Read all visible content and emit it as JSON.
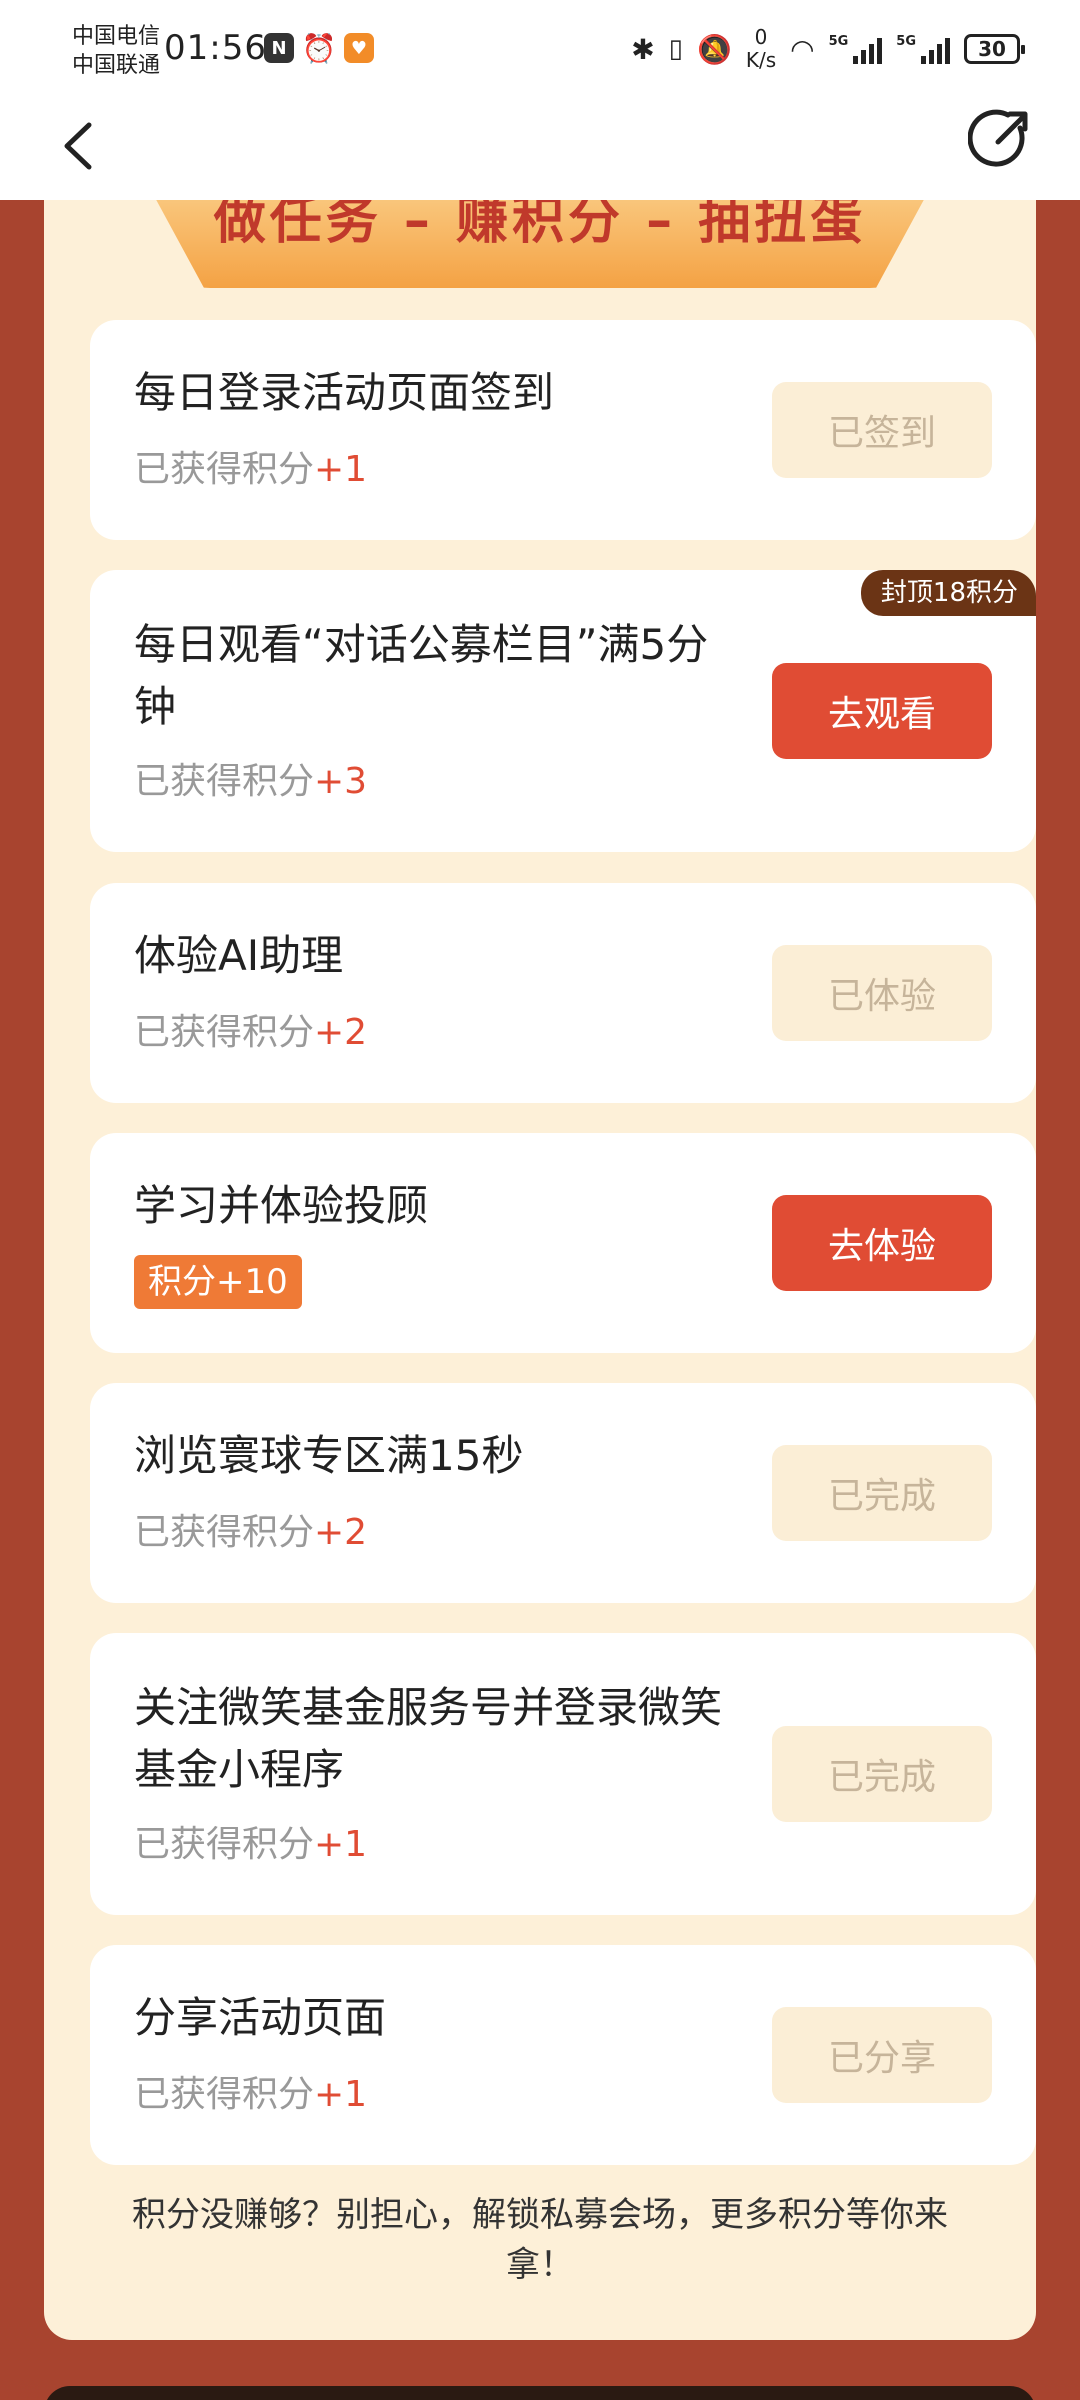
{
  "status_bar": {
    "carrier_1": "中国电信",
    "carrier_2": "中国联通",
    "time": "01:56",
    "net_speed_value": "0",
    "net_speed_unit": "K/s",
    "signal_1_label": "5G",
    "signal_2_label": "5G",
    "battery": "30"
  },
  "nav": {
    "back_icon": "chevron-left-icon",
    "share_icon": "share-icon"
  },
  "banner": {
    "title": "做任务 – 赚积分 – 抽扭蛋"
  },
  "tasks": [
    {
      "title": "每日登录活动页面签到",
      "points_prefix": "已获得积分",
      "points_value": "+1",
      "button": "已签到"
    },
    {
      "title": "每日观看“对话公募栏目”满5分钟",
      "points_prefix": "已获得积分",
      "points_value": "+3",
      "button": "去观看",
      "cap_tag": "封顶18积分"
    },
    {
      "title": "体验AI助理",
      "points_prefix": "已获得积分",
      "points_value": "+2",
      "button": "已体验"
    },
    {
      "title": "学习并体验投顾",
      "points_badge": "积分+10",
      "button": "去体验"
    },
    {
      "title": "浏览寰球专区满15秒",
      "points_prefix": "已获得积分",
      "points_value": "+2",
      "button": "已完成"
    },
    {
      "title": "关注微笑基金服务号并登录微笑基金小程序",
      "points_prefix": "已获得积分",
      "points_value": "+1",
      "button": "已完成"
    },
    {
      "title": "分享活动页面",
      "points_prefix": "已获得积分",
      "points_value": "+1",
      "button": "已分享"
    }
  ],
  "footer_note": "积分没赚够？别担心，解锁私募会场，更多积分等你来拿！",
  "colors": {
    "page_bg": "#a8442f",
    "panel_bg": "#fdf0d8",
    "accent": "#e04c34",
    "badge": "#ef7a36",
    "done_button_bg": "#fbeed6",
    "cap_tag_bg": "#6b3415"
  }
}
